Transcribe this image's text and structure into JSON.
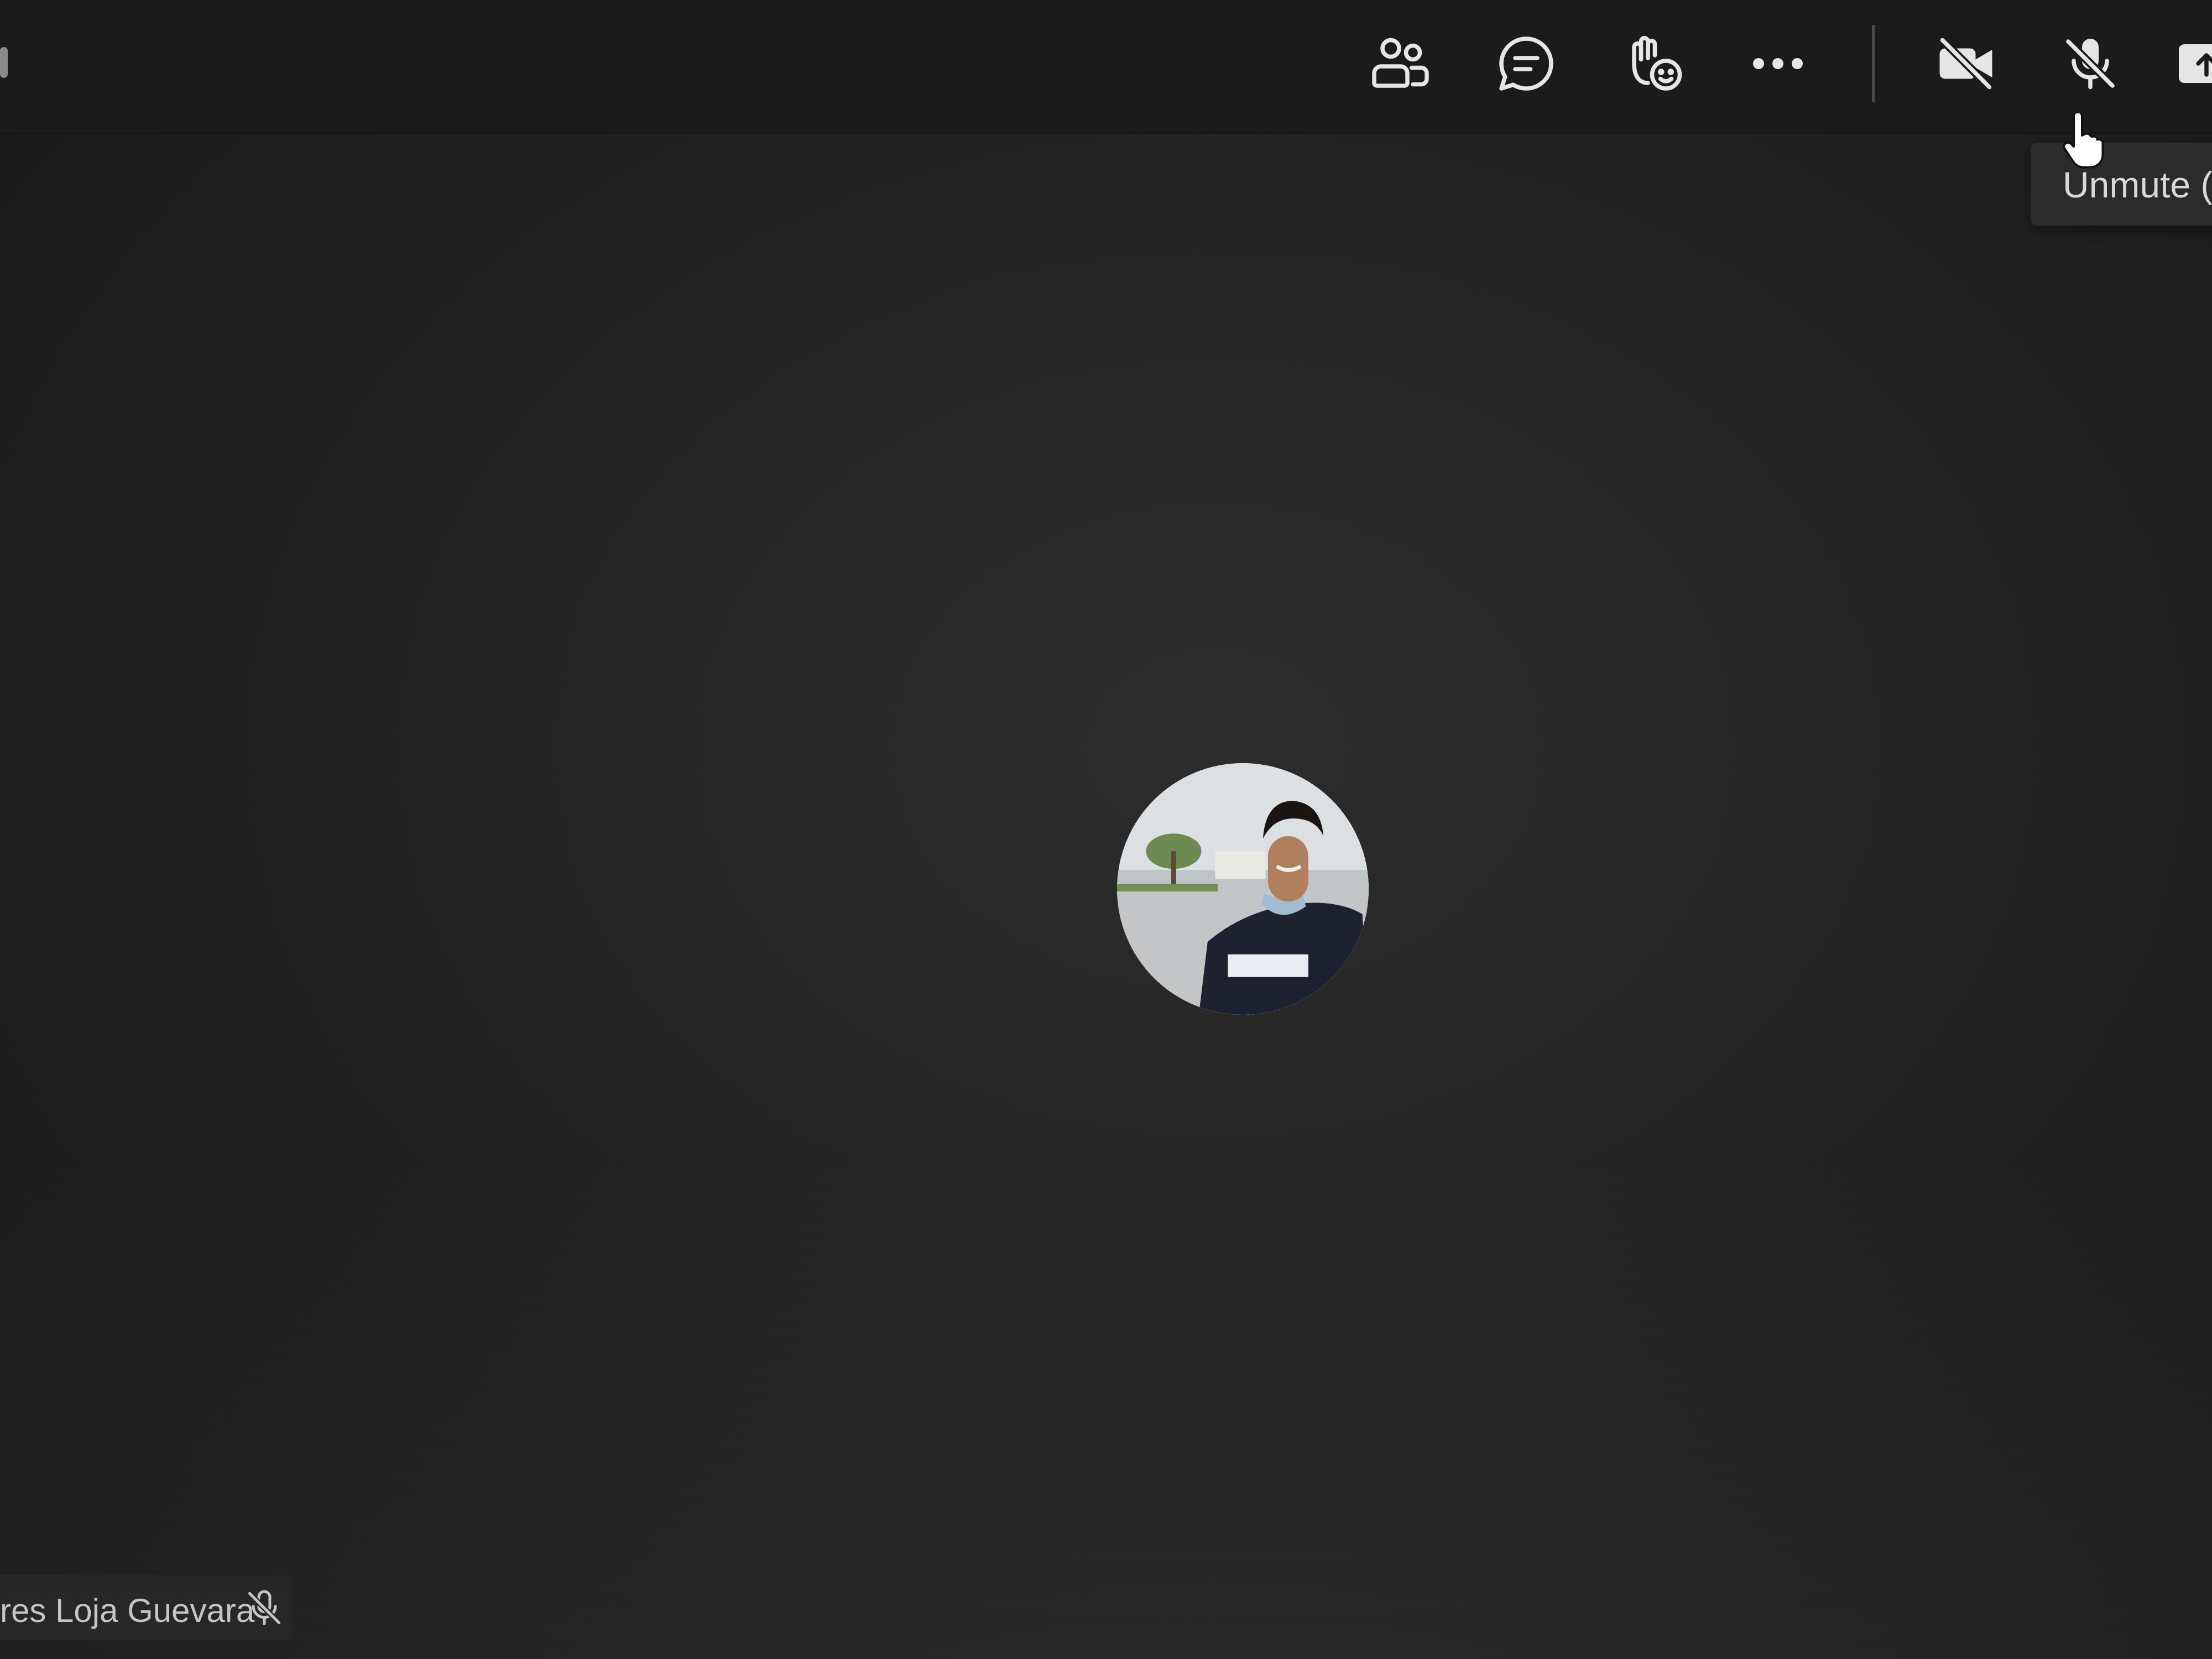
{
  "toolbar": {
    "buttons": [
      {
        "name": "people",
        "icon": "people-icon"
      },
      {
        "name": "chat",
        "icon": "chat-icon"
      },
      {
        "name": "react",
        "icon": "raise-hand-react-icon"
      },
      {
        "name": "more",
        "icon": "more-options-icon"
      },
      {
        "name": "camera",
        "icon": "camera-off-icon"
      },
      {
        "name": "mic",
        "icon": "mic-off-icon"
      },
      {
        "name": "share",
        "icon": "share-icon"
      }
    ]
  },
  "tooltip": {
    "text": "Unmute ("
  },
  "participant": {
    "name": "res Loja Guevara",
    "muted": true,
    "mic_icon": "mic-off-icon",
    "avatar": "profile-photo"
  },
  "colors": {
    "background": "#202020",
    "toolbar": "#1b1b1b",
    "icon": "#e6e6e6",
    "text": "#dcdcdc"
  }
}
